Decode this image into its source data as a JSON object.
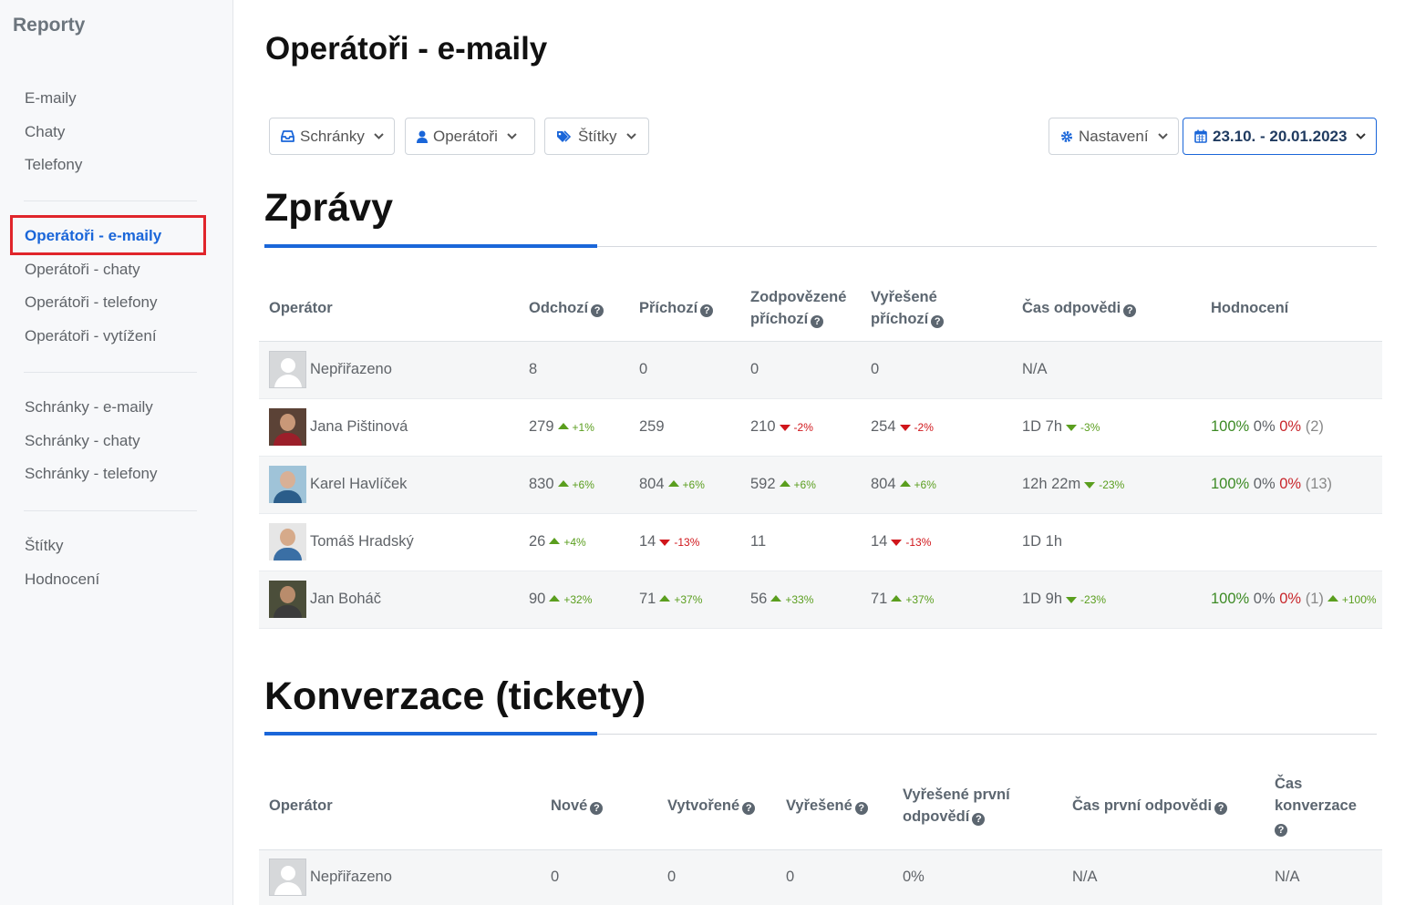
{
  "sidebar": {
    "title": "Reporty",
    "groups": [
      [
        {
          "label": "E-maily"
        },
        {
          "label": "Chaty"
        },
        {
          "label": "Telefony"
        }
      ],
      [
        {
          "label": "Operátoři - e-maily"
        },
        {
          "label": "Operátoři - chaty"
        },
        {
          "label": "Operátoři - telefony"
        },
        {
          "label": "Operátoři - vytížení"
        }
      ],
      [
        {
          "label": "Schránky - e-maily"
        },
        {
          "label": "Schránky - chaty"
        },
        {
          "label": "Schránky - telefony"
        }
      ],
      [
        {
          "label": "Štítky"
        },
        {
          "label": "Hodnocení"
        }
      ]
    ],
    "active_item": "Operátoři - e-maily",
    "highlight_color": "#e0252b"
  },
  "page": {
    "title": "Operátoři - e-maily"
  },
  "filters": {
    "inboxes": "Schránky",
    "operators": "Operátoři",
    "tags": "Štítky",
    "settings": "Nastavení",
    "date_range": "23.10. - 20.01.2023"
  },
  "colors": {
    "accent": "#1a66d9",
    "positive": "#5a9e1e",
    "negative": "#d0161b"
  },
  "messages": {
    "title": "Zprávy",
    "headers": {
      "operator": "Operátor",
      "outgoing": "Odchozí",
      "incoming": "Příchozí",
      "answered_1": "Zodpovězené",
      "answered_2": "příchozí",
      "resolved_1": "Vyřešené",
      "resolved_2": "příchozí",
      "response_time": "Čas odpovědi",
      "rating": "Hodnocení"
    },
    "rows": [
      {
        "name": "Nepřiřazeno",
        "avatar": "placeholder",
        "outgoing": {
          "v": "8"
        },
        "incoming": {
          "v": "0"
        },
        "answered": {
          "v": "0"
        },
        "resolved": {
          "v": "0"
        },
        "response_time": {
          "v": "N/A"
        },
        "rating": null
      },
      {
        "name": "Jana Pištinová",
        "avatar": "photo-jana",
        "outgoing": {
          "v": "279",
          "t": "up",
          "p": "+1%"
        },
        "incoming": {
          "v": "259"
        },
        "answered": {
          "v": "210",
          "t": "down",
          "p": "-2%"
        },
        "resolved": {
          "v": "254",
          "t": "down",
          "p": "-2%"
        },
        "response_time": {
          "v": "1D 7h",
          "t": "down-good",
          "p": "-3%"
        },
        "rating": {
          "pos": "100%",
          "neu": "0%",
          "neg": "0%",
          "count": "(2)"
        }
      },
      {
        "name": "Karel Havlíček",
        "avatar": "photo-karel",
        "outgoing": {
          "v": "830",
          "t": "up",
          "p": "+6%"
        },
        "incoming": {
          "v": "804",
          "t": "up",
          "p": "+6%"
        },
        "answered": {
          "v": "592",
          "t": "up",
          "p": "+6%"
        },
        "resolved": {
          "v": "804",
          "t": "up",
          "p": "+6%"
        },
        "response_time": {
          "v": "12h 22m",
          "t": "down-good",
          "p": "-23%"
        },
        "rating": {
          "pos": "100%",
          "neu": "0%",
          "neg": "0%",
          "count": "(13)"
        }
      },
      {
        "name": "Tomáš Hradský",
        "avatar": "photo-tomas",
        "outgoing": {
          "v": "26",
          "t": "up",
          "p": "+4%"
        },
        "incoming": {
          "v": "14",
          "t": "down",
          "p": "-13%"
        },
        "answered": {
          "v": "11"
        },
        "resolved": {
          "v": "14",
          "t": "down",
          "p": "-13%"
        },
        "response_time": {
          "v": "1D 1h"
        },
        "rating": null
      },
      {
        "name": "Jan Boháč",
        "avatar": "photo-jan",
        "outgoing": {
          "v": "90",
          "t": "up",
          "p": "+32%"
        },
        "incoming": {
          "v": "71",
          "t": "up",
          "p": "+37%"
        },
        "answered": {
          "v": "56",
          "t": "up",
          "p": "+33%"
        },
        "resolved": {
          "v": "71",
          "t": "up",
          "p": "+37%"
        },
        "response_time": {
          "v": "1D 9h",
          "t": "down-good",
          "p": "-23%"
        },
        "rating": {
          "pos": "100%",
          "neu": "0%",
          "neg": "0%",
          "count": "(1)",
          "t": "up",
          "p": "+100%"
        }
      }
    ]
  },
  "conversations": {
    "title": "Konverzace (tickety)",
    "headers": {
      "operator": "Operátor",
      "new": "Nové",
      "created": "Vytvořené",
      "resolved": "Vyřešené",
      "first_resolved_1": "Vyřešené první",
      "first_resolved_2": "odpovědí",
      "first_response_time": "Čas první odpovědi",
      "conversation_time_1": "Čas",
      "conversation_time_2": "konverzace"
    },
    "rows": [
      {
        "name": "Nepřiřazeno",
        "avatar": "placeholder",
        "new": "0",
        "created": "0",
        "resolved": "0",
        "first_resolved": "0%",
        "first_response_time": "N/A",
        "conversation_time": "N/A"
      }
    ]
  }
}
